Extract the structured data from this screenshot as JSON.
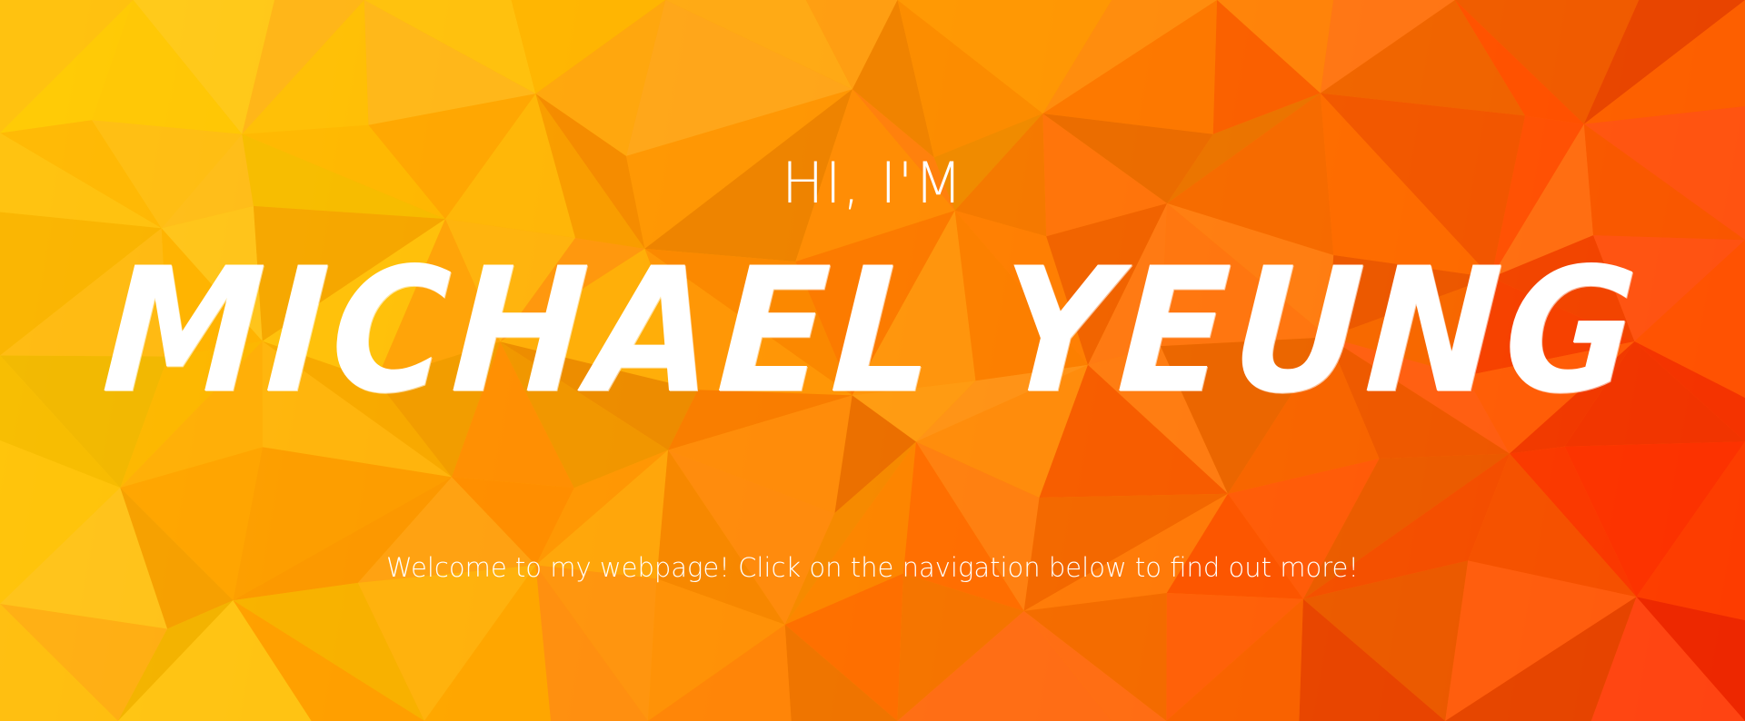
{
  "hero": {
    "greeting": "HI, I'M",
    "name": "MICHAEL YEUNG",
    "welcome": "Welcome to my webpage! Click on the navigation below to find out more!"
  },
  "colors": {
    "accent_yellow": "#ffd21a",
    "accent_orange": "#ff9800",
    "accent_red": "#ff4a00",
    "text": "#ffffff"
  }
}
